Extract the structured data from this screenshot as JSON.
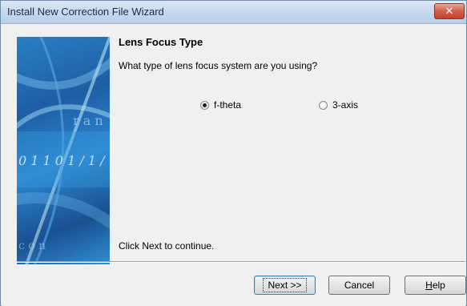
{
  "window": {
    "title": "Install New Correction File Wizard",
    "close_glyph": "✕"
  },
  "page": {
    "heading": "Lens Focus Type",
    "question": "What type of lens focus system are you using?",
    "footer_note": "Click Next to continue."
  },
  "options": [
    {
      "label": "f-theta",
      "selected": true
    },
    {
      "label": "3-axis",
      "selected": false
    }
  ],
  "buttons": {
    "next": "Next >>",
    "cancel": "Cancel",
    "help_first": "H",
    "help_rest": "elp"
  },
  "side_image": {
    "text": [
      "r a n",
      "0 1 1 0 1 / 1 /",
      "c o n"
    ],
    "icon": "wizard-banner-image"
  },
  "colors": {
    "accent": "#2b86cf",
    "close": "#c2422c"
  }
}
